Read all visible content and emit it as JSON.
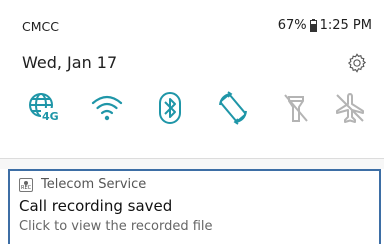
{
  "status_bar": {
    "carrier": "CMCC",
    "battery_percent": "67%",
    "time": "1:25 PM"
  },
  "quick_settings": {
    "date": "Wed, Jan 17",
    "icons": {
      "settings": "gear-icon",
      "data": "globe-4g-icon",
      "wifi": "wifi-icon",
      "bluetooth": "bluetooth-icon",
      "rotation": "auto-rotate-icon",
      "flashlight": "flashlight-off-icon",
      "airplane": "airplane-off-icon"
    },
    "toggles": {
      "data_label": "4G"
    },
    "colors": {
      "active": "#1f96a8",
      "inactive": "#b4b4b4"
    }
  },
  "notification": {
    "app_name": "Telecom Service",
    "app_icon_text": "REC",
    "title": "Call recording saved",
    "body": "Click to view the recorded file",
    "accent": "#3d6ea5"
  }
}
